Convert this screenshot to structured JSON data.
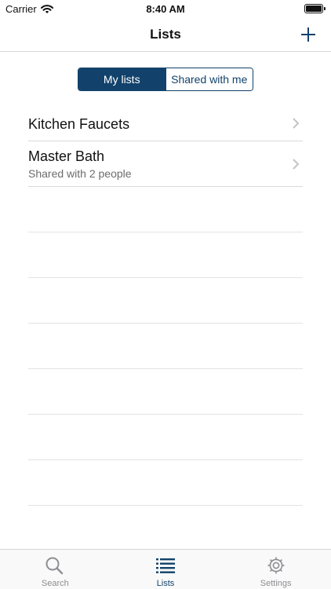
{
  "status_bar": {
    "carrier": "Carrier",
    "time": "8:40 AM"
  },
  "nav": {
    "title": "Lists",
    "add_icon": "plus-icon"
  },
  "segmented": {
    "options": [
      "My lists",
      "Shared with me"
    ],
    "selected": "My lists"
  },
  "lists": [
    {
      "title": "Kitchen Faucets",
      "subtitle": ""
    },
    {
      "title": "Master Bath",
      "subtitle": "Shared with 2 people"
    }
  ],
  "tabs": [
    {
      "label": "Search",
      "icon": "search-icon",
      "active": false
    },
    {
      "label": "Lists",
      "icon": "list-icon",
      "active": true
    },
    {
      "label": "Settings",
      "icon": "gear-icon",
      "active": false
    }
  ],
  "colors": {
    "accent": "#12426b",
    "inactive": "#8e8e93",
    "separator": "#d9d9d9"
  }
}
